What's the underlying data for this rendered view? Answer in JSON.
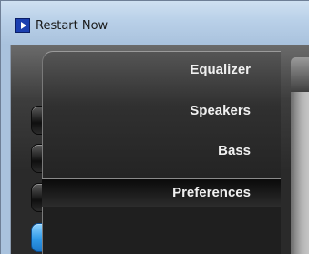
{
  "window": {
    "title": "Restart Now",
    "app_icon": "play-icon"
  },
  "menu": {
    "items": [
      {
        "label": "Equalizer",
        "selected": false
      },
      {
        "label": "Speakers",
        "selected": false
      },
      {
        "label": "Bass",
        "selected": false
      },
      {
        "label": "Preferences",
        "selected": true
      }
    ]
  },
  "colors": {
    "accent": "#2f99e8",
    "menu_bg": "#303030",
    "title_bar": "#b9d0e8"
  }
}
